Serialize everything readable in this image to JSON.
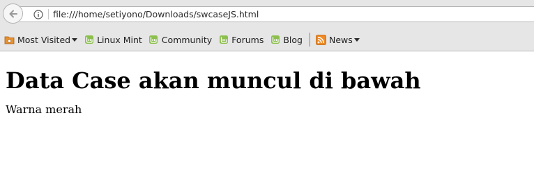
{
  "browser": {
    "url": "file:///home/setiyono/Downloads/swcaseJS.html",
    "bookmarks": [
      {
        "label": "Most Visited",
        "icon": "folder-icon",
        "dropdown": true
      },
      {
        "label": "Linux Mint",
        "icon": "mint-icon",
        "dropdown": false
      },
      {
        "label": "Community",
        "icon": "mint-icon",
        "dropdown": false
      },
      {
        "label": "Forums",
        "icon": "mint-icon",
        "dropdown": false
      },
      {
        "label": "Blog",
        "icon": "mint-icon",
        "dropdown": false
      },
      {
        "label": "News",
        "icon": "rss-icon",
        "dropdown": true
      }
    ]
  },
  "page": {
    "heading": "Data Case akan muncul di bawah",
    "text": "Warna merah"
  },
  "colors": {
    "mint_green": "#8cbf4d",
    "folder_orange": "#e8912e",
    "rss_orange": "#f08a24"
  }
}
